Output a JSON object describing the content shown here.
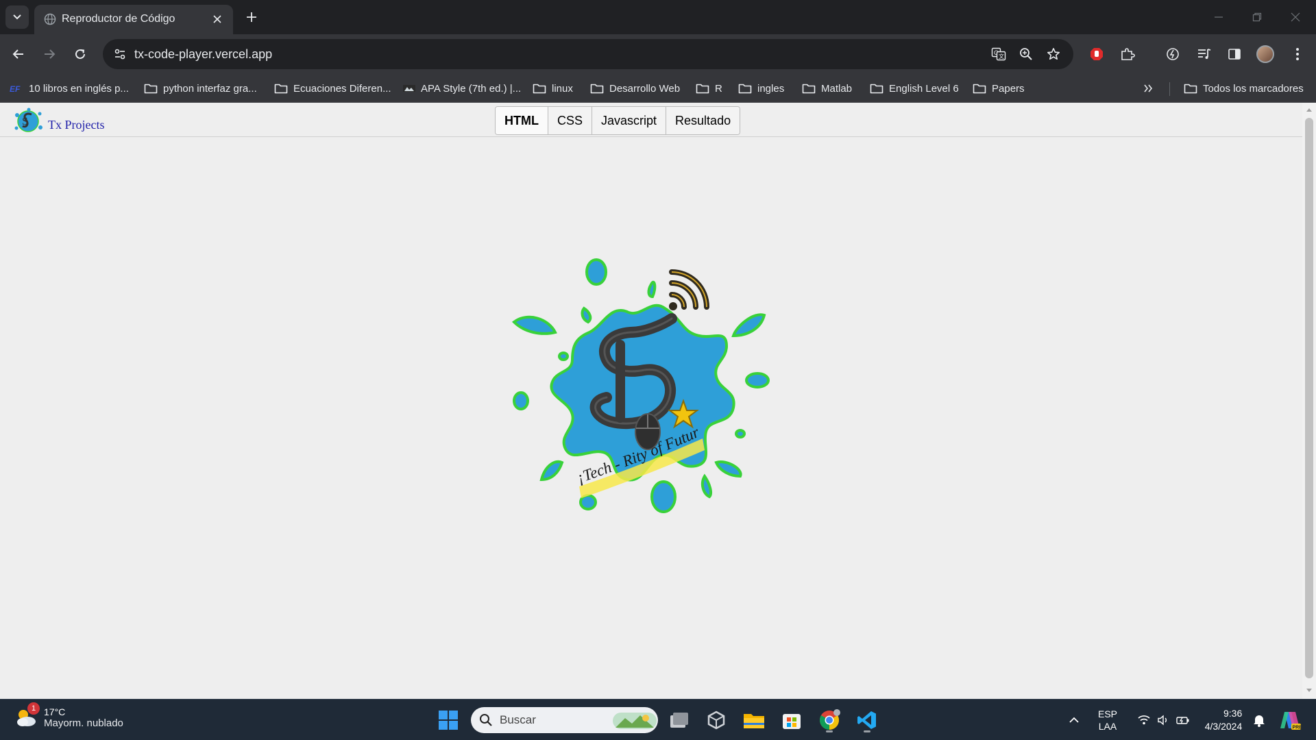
{
  "browser": {
    "tab_title": "Reproductor de Código",
    "url": "tx-code-player.vercel.app",
    "bookmarks": [
      {
        "label": "10 libros en inglés p...",
        "icon": "ef-icon"
      },
      {
        "label": "python interfaz gra...",
        "icon": "folder-icon"
      },
      {
        "label": "Ecuaciones Diferen...",
        "icon": "folder-icon"
      },
      {
        "label": "APA Style (7th ed.) |...",
        "icon": "apa-icon"
      },
      {
        "label": "linux",
        "icon": "folder-icon"
      },
      {
        "label": "Desarrollo Web",
        "icon": "folder-icon"
      },
      {
        "label": "R",
        "icon": "folder-icon"
      },
      {
        "label": "ingles",
        "icon": "folder-icon"
      },
      {
        "label": "Matlab",
        "icon": "folder-icon"
      },
      {
        "label": "English Level 6",
        "icon": "folder-icon"
      },
      {
        "label": "Papers",
        "icon": "folder-icon"
      }
    ],
    "all_bookmarks": "Todos los marcadores"
  },
  "page": {
    "brand": "Tx Projects",
    "toggles": [
      "HTML",
      "CSS",
      "Javascript",
      "Resultado"
    ],
    "active_toggle": "HTML",
    "logo_text": "¡Tech - Rity of Future!"
  },
  "taskbar": {
    "weather_temp": "17°C",
    "weather_desc": "Mayorm. nublado",
    "weather_badge": "1",
    "search_placeholder": "Buscar",
    "lang_top": "ESP",
    "lang_bottom": "LAA",
    "time": "9:36",
    "date": "4/3/2024"
  },
  "colors": {
    "chrome_dark": "#202124",
    "chrome_toolbar": "#35363a",
    "page_bg": "#eeeeee",
    "brand_blue": "#2222aa",
    "splash_blue": "#2e9fd8",
    "splash_outline": "#39d13a"
  }
}
